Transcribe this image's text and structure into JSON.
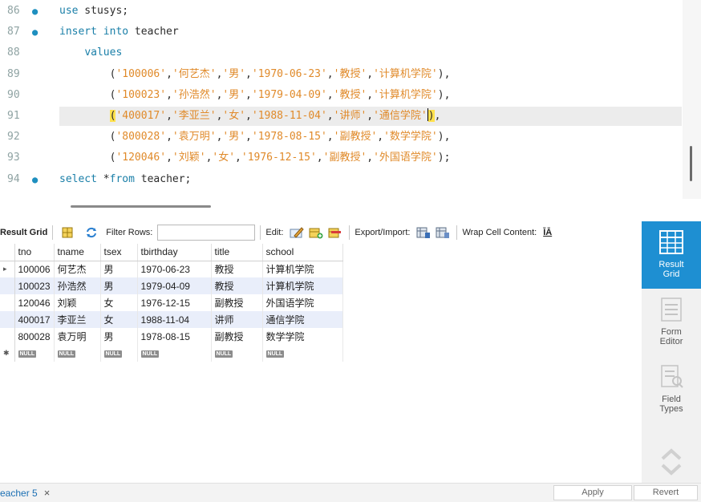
{
  "editor": {
    "lines": [
      {
        "num": "86",
        "dot": true,
        "segments": [
          {
            "c": "kw",
            "t": "use"
          },
          {
            "c": "pl",
            "t": " stusys;"
          }
        ]
      },
      {
        "num": "87",
        "dot": true,
        "segments": [
          {
            "c": "kw",
            "t": "insert into"
          },
          {
            "c": "pl",
            "t": " teacher"
          }
        ]
      },
      {
        "num": "88",
        "dot": false,
        "segments": [
          {
            "c": "pl",
            "t": "    "
          },
          {
            "c": "kw",
            "t": "values"
          }
        ]
      },
      {
        "num": "89",
        "dot": false,
        "segments": [
          {
            "c": "pl",
            "t": "        ("
          },
          {
            "c": "str",
            "t": "'100006'"
          },
          {
            "c": "pl",
            "t": ","
          },
          {
            "c": "str",
            "t": "'何艺杰'"
          },
          {
            "c": "pl",
            "t": ","
          },
          {
            "c": "str",
            "t": "'男'"
          },
          {
            "c": "pl",
            "t": ","
          },
          {
            "c": "str",
            "t": "'1970-06-23'"
          },
          {
            "c": "pl",
            "t": ","
          },
          {
            "c": "str",
            "t": "'教授'"
          },
          {
            "c": "pl",
            "t": ","
          },
          {
            "c": "str",
            "t": "'计算机学院'"
          },
          {
            "c": "pl",
            "t": "),"
          }
        ]
      },
      {
        "num": "90",
        "dot": false,
        "segments": [
          {
            "c": "pl",
            "t": "        ("
          },
          {
            "c": "str",
            "t": "'100023'"
          },
          {
            "c": "pl",
            "t": ","
          },
          {
            "c": "str",
            "t": "'孙浩然'"
          },
          {
            "c": "pl",
            "t": ","
          },
          {
            "c": "str",
            "t": "'男'"
          },
          {
            "c": "pl",
            "t": ","
          },
          {
            "c": "str",
            "t": "'1979-04-09'"
          },
          {
            "c": "pl",
            "t": ","
          },
          {
            "c": "str",
            "t": "'教授'"
          },
          {
            "c": "pl",
            "t": ","
          },
          {
            "c": "str",
            "t": "'计算机学院'"
          },
          {
            "c": "pl",
            "t": "),"
          }
        ]
      },
      {
        "num": "91",
        "dot": false,
        "current": true,
        "segments": [
          {
            "c": "pl",
            "t": "        "
          },
          {
            "c": "pl hl",
            "t": "("
          },
          {
            "c": "str",
            "t": "'400017'"
          },
          {
            "c": "pl",
            "t": ","
          },
          {
            "c": "str",
            "t": "'李亚兰'"
          },
          {
            "c": "pl",
            "t": ","
          },
          {
            "c": "str",
            "t": "'女'"
          },
          {
            "c": "pl",
            "t": ","
          },
          {
            "c": "str",
            "t": "'1988-11-04'"
          },
          {
            "c": "pl",
            "t": ","
          },
          {
            "c": "str",
            "t": "'讲师'"
          },
          {
            "c": "pl",
            "t": ","
          },
          {
            "c": "str",
            "t": "'通信学院'"
          },
          {
            "c": "caret",
            "t": ""
          },
          {
            "c": "pl hl",
            "t": ")"
          },
          {
            "c": "pl",
            "t": ","
          }
        ]
      },
      {
        "num": "92",
        "dot": false,
        "segments": [
          {
            "c": "pl",
            "t": "        ("
          },
          {
            "c": "str",
            "t": "'800028'"
          },
          {
            "c": "pl",
            "t": ","
          },
          {
            "c": "str",
            "t": "'袁万明'"
          },
          {
            "c": "pl",
            "t": ","
          },
          {
            "c": "str",
            "t": "'男'"
          },
          {
            "c": "pl",
            "t": ","
          },
          {
            "c": "str",
            "t": "'1978-08-15'"
          },
          {
            "c": "pl",
            "t": ","
          },
          {
            "c": "str",
            "t": "'副教授'"
          },
          {
            "c": "pl",
            "t": ","
          },
          {
            "c": "str",
            "t": "'数学学院'"
          },
          {
            "c": "pl",
            "t": "),"
          }
        ]
      },
      {
        "num": "93",
        "dot": false,
        "segments": [
          {
            "c": "pl",
            "t": "        ("
          },
          {
            "c": "str",
            "t": "'120046'"
          },
          {
            "c": "pl",
            "t": ","
          },
          {
            "c": "str",
            "t": "'刘颖'"
          },
          {
            "c": "pl",
            "t": ","
          },
          {
            "c": "str",
            "t": "'女'"
          },
          {
            "c": "pl",
            "t": ","
          },
          {
            "c": "str",
            "t": "'1976-12-15'"
          },
          {
            "c": "pl",
            "t": ","
          },
          {
            "c": "str",
            "t": "'副教授'"
          },
          {
            "c": "pl",
            "t": ","
          },
          {
            "c": "str",
            "t": "'外国语学院'"
          },
          {
            "c": "pl",
            "t": ");"
          }
        ]
      },
      {
        "num": "94",
        "dot": true,
        "segments": [
          {
            "c": "kw",
            "t": "select"
          },
          {
            "c": "pl",
            "t": " *"
          },
          {
            "c": "kw",
            "t": "from"
          },
          {
            "c": "pl",
            "t": " teacher;"
          }
        ]
      }
    ]
  },
  "toolbar": {
    "result_grid_label": "Result Grid",
    "filter_rows_label": "Filter Rows:",
    "filter_value": "",
    "edit_label": "Edit:",
    "export_label": "Export/Import:",
    "wrap_label": "Wrap Cell Content:",
    "wrap_icon_text": "ĪĀ"
  },
  "grid": {
    "columns": [
      "tno",
      "tname",
      "tsex",
      "tbirthday",
      "title",
      "school"
    ],
    "rows": [
      [
        "100006",
        "何艺杰",
        "男",
        "1970-06-23",
        "教授",
        "计算机学院"
      ],
      [
        "100023",
        "孙浩然",
        "男",
        "1979-04-09",
        "教授",
        "计算机学院"
      ],
      [
        "120046",
        "刘颖",
        "女",
        "1976-12-15",
        "副教授",
        "外国语学院"
      ],
      [
        "400017",
        "李亚兰",
        "女",
        "1988-11-04",
        "讲师",
        "通信学院"
      ],
      [
        "800028",
        "袁万明",
        "男",
        "1978-08-15",
        "副教授",
        "数学学院"
      ]
    ],
    "null_label": "NULL",
    "current_row_marker": "▸",
    "new_row_marker": "✱"
  },
  "side_panel": {
    "items": [
      {
        "label_1": "Result",
        "label_2": "Grid"
      },
      {
        "label_1": "Form",
        "label_2": "Editor"
      },
      {
        "label_1": "Field",
        "label_2": "Types"
      }
    ]
  },
  "bottom": {
    "tab_label": "eacher 5",
    "tab_close": "×",
    "apply_label": "Apply",
    "revert_label": "Revert"
  },
  "colors": {
    "keyword": "#1a7fa8",
    "string": "#e08a2a",
    "active_panel": "#1e8fd2",
    "striped_row": "#e9eefa",
    "bracket_highlight": "#ffe14d"
  }
}
